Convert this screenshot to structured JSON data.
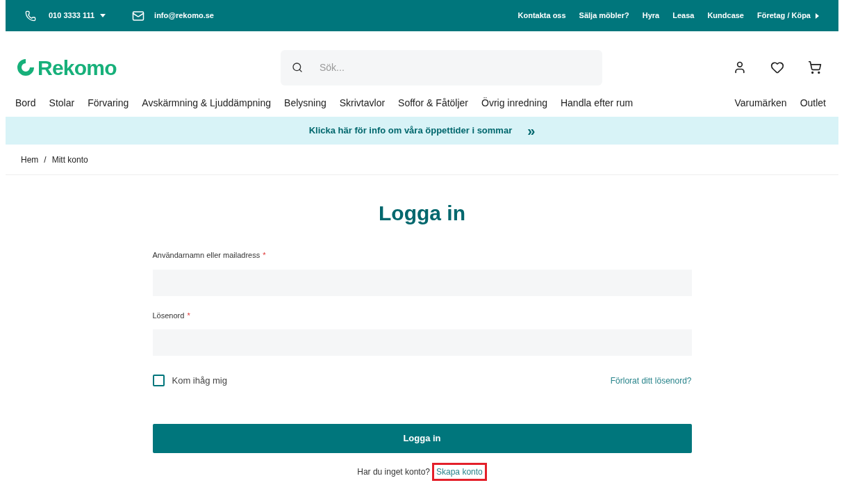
{
  "top_bar": {
    "phone": "010 3333 111",
    "email": "info@rekomo.se",
    "links": [
      "Kontakta oss",
      "Sälja möbler?",
      "Hyra",
      "Leasa",
      "Kundcase",
      "Företag / Köpa"
    ]
  },
  "header": {
    "logo": "Rekomo",
    "search": {
      "placeholder": "Sök..."
    }
  },
  "nav": {
    "left": [
      "Bord",
      "Stolar",
      "Förvaring",
      "Avskärmning & Ljuddämpning",
      "Belysning",
      "Skrivtavlor",
      "Soffor & Fåtöljer",
      "Övrig inredning",
      "Handla efter rum"
    ],
    "right": [
      "Varumärken",
      "Outlet"
    ]
  },
  "banner": {
    "text": "Klicka här för info om våra öppettider i sommar",
    "icon_text": "»"
  },
  "breadcrumb": [
    "Hem",
    "Mitt konto"
  ],
  "breadcrumb_separator": "/",
  "login": {
    "title": "Logga in",
    "fields": [
      {
        "label": "Användarnamn eller mailadress",
        "required_mark": "*"
      },
      {
        "label": "Lösenord",
        "required_mark": "*"
      }
    ],
    "remember": {
      "label": "Kom ihåg mig",
      "checked": false
    },
    "forgot_link": "Förlorat ditt lösenord?",
    "submit": "Logga in",
    "signup_prompt": "Har du inget konto?",
    "signup_link": {
      "text": "Skapa konto",
      "highlighted": true
    }
  }
}
